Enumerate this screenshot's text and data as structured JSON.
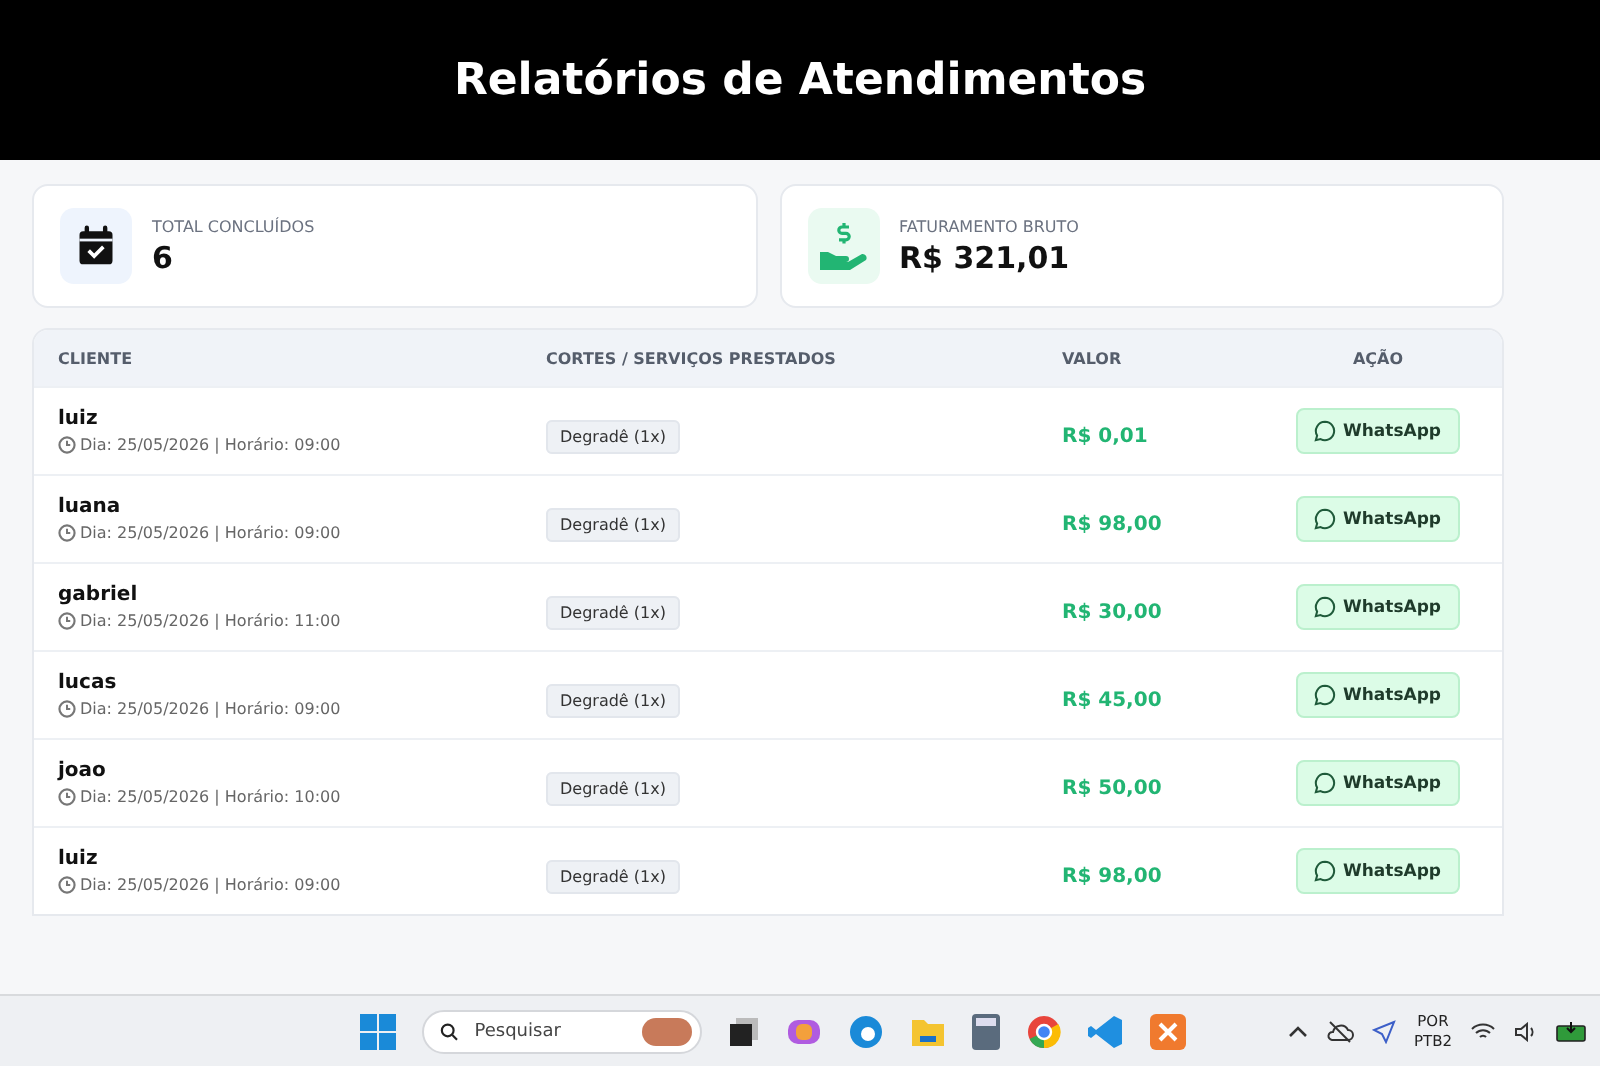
{
  "header": {
    "title": "Relatórios de Atendimentos"
  },
  "stats": [
    {
      "kind": "calendar",
      "label": "TOTAL CONCLUÍDOS",
      "value": "6"
    },
    {
      "kind": "money",
      "label": "FATURAMENTO BRUTO",
      "value": "R$ 321,01"
    }
  ],
  "table": {
    "columns": [
      "CLIENTE",
      "CORTES / SERVIÇOS PRESTADOS",
      "VALOR",
      "AÇÃO"
    ],
    "rows": [
      {
        "name": "luiz",
        "schedule": "Dia: 25/05/2026 | Horário: 09:00",
        "service": "Degradê (1x)",
        "value": "R$ 0,01",
        "action": "WhatsApp"
      },
      {
        "name": "luana",
        "schedule": "Dia: 25/05/2026 | Horário: 09:00",
        "service": "Degradê (1x)",
        "value": "R$ 98,00",
        "action": "WhatsApp"
      },
      {
        "name": "gabriel",
        "schedule": "Dia: 25/05/2026 | Horário: 11:00",
        "service": "Degradê (1x)",
        "value": "R$ 30,00",
        "action": "WhatsApp"
      },
      {
        "name": "lucas",
        "schedule": "Dia: 25/05/2026 | Horário: 09:00",
        "service": "Degradê (1x)",
        "value": "R$ 45,00",
        "action": "WhatsApp"
      },
      {
        "name": "joao",
        "schedule": "Dia: 25/05/2026 | Horário: 10:00",
        "service": "Degradê (1x)",
        "value": "R$ 50,00",
        "action": "WhatsApp"
      },
      {
        "name": "luiz",
        "schedule": "Dia: 25/05/2026 | Horário: 09:00",
        "service": "Degradê (1x)",
        "value": "R$ 98,00",
        "action": "WhatsApp"
      }
    ]
  },
  "taskbar": {
    "search": {
      "placeholder": "Pesquisar"
    },
    "language": "POR",
    "layout": "PTB2"
  }
}
